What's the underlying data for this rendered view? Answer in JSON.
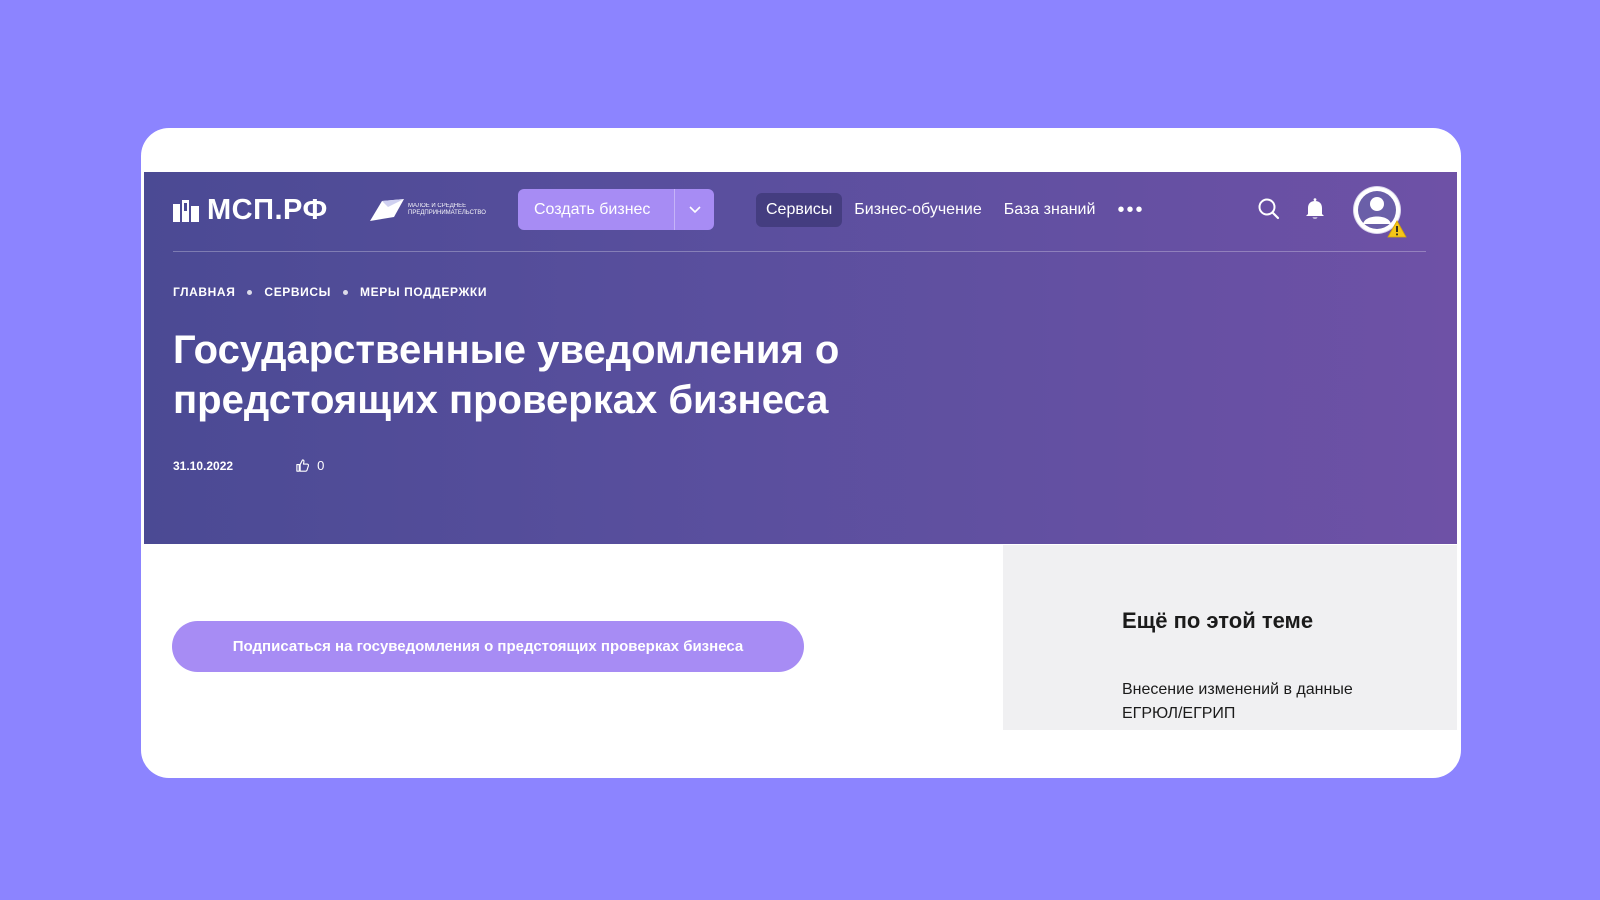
{
  "header": {
    "logo_text": "МСП.РФ",
    "badge_text": "МАЛОЕ И СРЕДНЕЕ ПРЕДПРИНИМАТЕЛЬСТВО",
    "create_business_label": "Создать бизнес",
    "nav": [
      {
        "label": "Сервисы",
        "active": true
      },
      {
        "label": "Бизнес-обучение",
        "active": false
      },
      {
        "label": "База знаний",
        "active": false
      }
    ],
    "more_label": "•••",
    "icons": [
      "search-icon",
      "bell-icon",
      "avatar-icon",
      "warning-icon"
    ]
  },
  "breadcrumb": [
    "ГЛАВНАЯ",
    "СЕРВИСЫ",
    "МЕРЫ ПОДДЕРЖКИ"
  ],
  "article": {
    "title": "Государственные уведомления о предстоящих проверках бизнеса",
    "date": "31.10.2022",
    "likes": "0",
    "subscribe_label": "Подписаться на госуведомления о предстоящих проверках бизнеса"
  },
  "aside": {
    "title": "Ещё по этой теме",
    "links": [
      "Внесение изменений в данные ЕГРЮЛ/ЕГРИП"
    ]
  },
  "colors": {
    "page_background": "#8c84ff",
    "hero_start": "#4b4a94",
    "hero_end": "#6e51a6",
    "accent_button": "#a78cf4",
    "aside_background": "#f0f0f2"
  }
}
